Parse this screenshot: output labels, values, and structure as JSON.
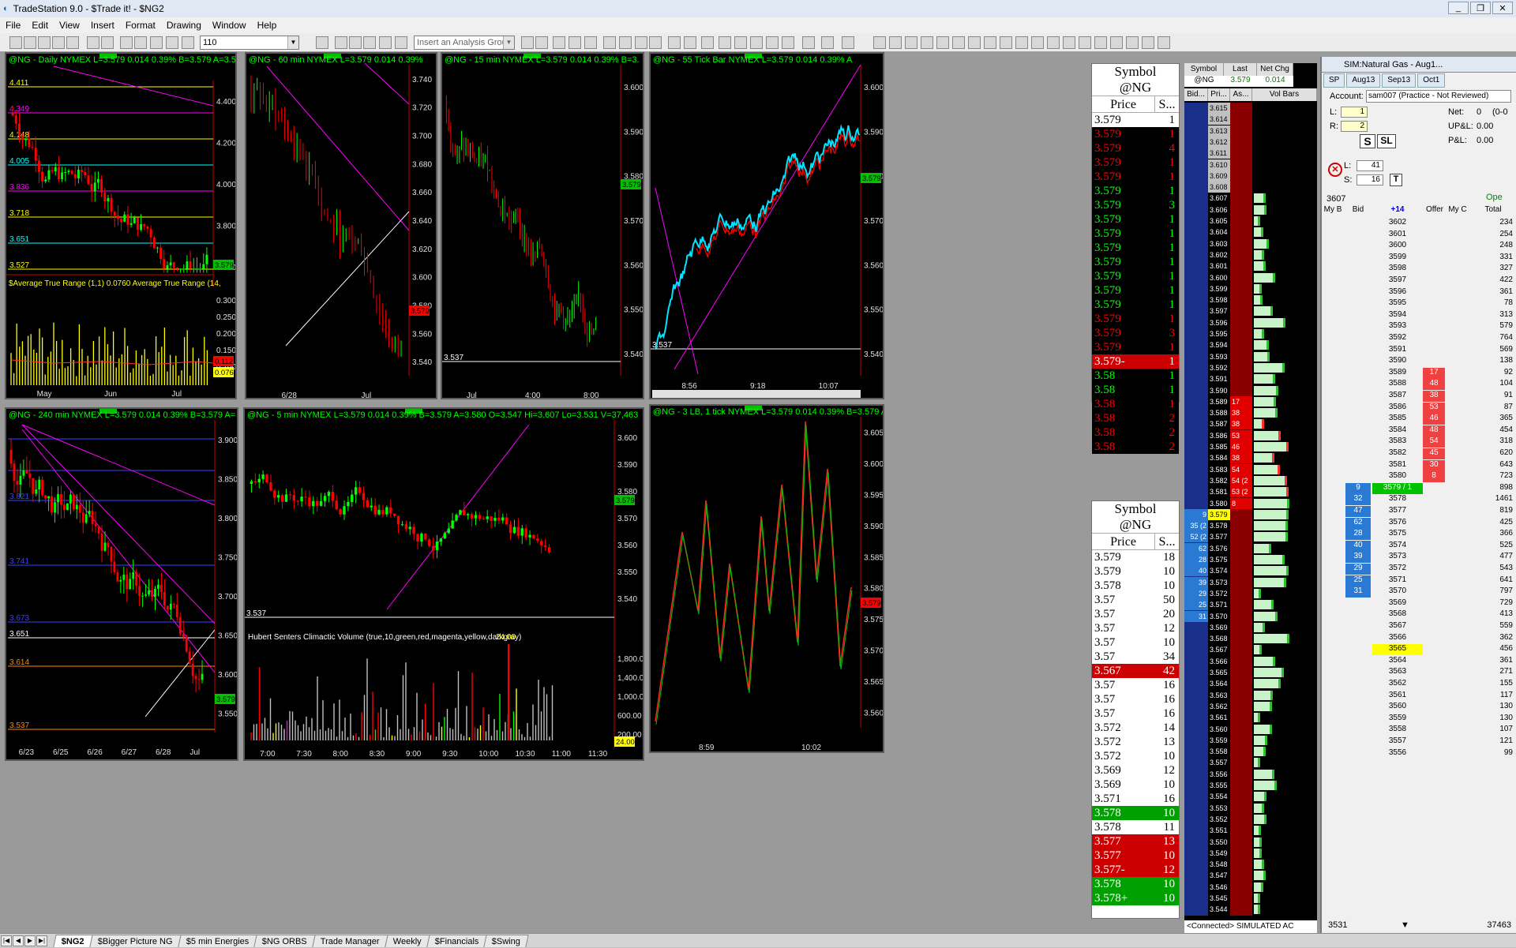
{
  "window": {
    "title": "TradeStation 9.0 - $Trade it! - $NG2",
    "controls": [
      "_",
      "❐",
      "✕"
    ]
  },
  "menu": [
    "File",
    "Edit",
    "View",
    "Insert",
    "Format",
    "Drawing",
    "Window",
    "Help"
  ],
  "toolbar": {
    "interval_value": "110",
    "analysis_placeholder": "Insert an Analysis Group"
  },
  "charts": [
    {
      "id": "daily",
      "header": "@NG - Daily  NYMEX  L=3.579  0.014  0.39%  B=3.579  A=3.5",
      "price_labels": [
        "4.400",
        "4.200",
        "4.000",
        "3.800",
        "3.600"
      ],
      "last": "3.579",
      "levels": [
        {
          "label": "4.411",
          "color": "#ffff00"
        },
        {
          "label": "4.349",
          "color": "#ff00ff"
        },
        {
          "label": "4.148",
          "color": "#ffff00"
        },
        {
          "label": "4.005",
          "color": "#00ffff"
        },
        {
          "label": "3.836",
          "color": "#ff00ff"
        },
        {
          "label": "3.718",
          "color": "#ffff00"
        },
        {
          "label": "3.651",
          "color": "#00ffff"
        },
        {
          "label": "3.527",
          "color": "#ffff00"
        }
      ],
      "indicator": "$Average True Range (1,1)  0.0760  Average True Range (14,",
      "ind_labels": [
        "0.300",
        "0.250",
        "0.200",
        "0.150",
        "0.100"
      ],
      "ind_last1": "0.112",
      "ind_last2": "0.076",
      "dates": [
        "May",
        "Jun",
        "Jul"
      ]
    },
    {
      "id": "60min",
      "header": "@NG - 60 min  NYMEX  L=3.579  0.014  0.39%",
      "price_labels": [
        "3.740",
        "3.720",
        "3.700",
        "3.680",
        "3.660",
        "3.640",
        "3.620",
        "3.600",
        "3.580",
        "3.560",
        "3.540"
      ],
      "last": "3.579",
      "dates": [
        "6/28",
        "Jul"
      ]
    },
    {
      "id": "15min",
      "header": "@NG - 15 min  NYMEX  L=3.579  0.014  0.39%  B=3.",
      "price_labels": [
        "3.600",
        "3.590",
        "3.580",
        "3.570",
        "3.560",
        "3.550",
        "3.540"
      ],
      "last": "3.579",
      "level": "3.537",
      "dates": [
        "Jul",
        "4:00",
        "8:00"
      ]
    },
    {
      "id": "55tick",
      "header": "@NG - 55 Tick Bar  NYMEX  L=3.579  0.014  0.39%  A",
      "price_labels": [
        "3.600",
        "3.590",
        "3.580",
        "3.570",
        "3.560",
        "3.550",
        "3.540"
      ],
      "last": "3.579",
      "level": "3.537",
      "dates": [
        "8:56",
        "9:18",
        "10:07"
      ]
    },
    {
      "id": "240min",
      "header": "@NG - 240 min  NYMEX  L=3.579  0.014  0.39%  B=3.579  A=",
      "price_labels": [
        "3.900",
        "3.850",
        "3.800",
        "3.750",
        "3.700",
        "3.650",
        "3.600",
        "3.550"
      ],
      "last": "3.579",
      "levels": [
        {
          "label": "3.821",
          "color": "#4040ff"
        },
        {
          "label": "3.741",
          "color": "#4040ff"
        },
        {
          "label": "3.673",
          "color": "#4040ff"
        },
        {
          "label": "3.651",
          "color": "#ffffff"
        },
        {
          "label": "3.614",
          "color": "#ff8800"
        },
        {
          "label": "3.537",
          "color": "#ff8800"
        }
      ],
      "dates": [
        "6/23",
        "6/25",
        "6/26",
        "6/27",
        "6/28",
        "Jul"
      ]
    },
    {
      "id": "5min",
      "header": "@NG - 5 min  NYMEX  L=3.579  0.014  0.39%  B=3.579  A=3.580  O=3.547  Hi=3.607  Lo=3.531  V=37,463",
      "price_labels": [
        "3.600",
        "3.590",
        "3.580",
        "3.570",
        "3.560",
        "3.550",
        "3.540"
      ],
      "last": "3.579",
      "level": "3.537",
      "indicator": "Hubert Senters Climactic Volume (true,10,green,red,magenta,yellow,darkgray)",
      "indicator_value": "24.00",
      "ind_labels": [
        "1,800.00",
        "1,400.00",
        "1,000.00",
        "600.00",
        "200.00"
      ],
      "ind_last": "24.00",
      "dates": [
        "7:00",
        "7:30",
        "8:00",
        "8:30",
        "9:00",
        "9:30",
        "10:00",
        "10:30",
        "11:00",
        "11:30"
      ]
    },
    {
      "id": "3lb",
      "header": "@NG - 3 LB, 1 tick  NYMEX  L=3.579  0.014  0.39%  B=3.579  A=",
      "price_labels": [
        "3.605",
        "3.600",
        "3.595",
        "3.590",
        "3.585",
        "3.580",
        "3.575",
        "3.570",
        "3.565",
        "3.560"
      ],
      "last": "3.579",
      "dates": [
        "8:59",
        "10:02"
      ]
    }
  ],
  "ts1": {
    "symbol_header": "Symbol",
    "symbol": "@NG",
    "price_header": "Price",
    "size_header": "S...",
    "rows": [
      [
        "3.579",
        "1",
        "w"
      ],
      [
        "3.579",
        "1",
        "r"
      ],
      [
        "3.579",
        "4",
        "r"
      ],
      [
        "3.579",
        "1",
        "r"
      ],
      [
        "3.579",
        "1",
        "r"
      ],
      [
        "3.579",
        "1",
        "g"
      ],
      [
        "3.579",
        "3",
        "g"
      ],
      [
        "3.579",
        "1",
        "g"
      ],
      [
        "3.579",
        "1",
        "g"
      ],
      [
        "3.579",
        "1",
        "g"
      ],
      [
        "3.579",
        "1",
        "g"
      ],
      [
        "3.579",
        "1",
        "g"
      ],
      [
        "3.579",
        "1",
        "g"
      ],
      [
        "3.579",
        "1",
        "g"
      ],
      [
        "3.579",
        "1",
        "r"
      ],
      [
        "3.579",
        "3",
        "r"
      ],
      [
        "3.579",
        "1",
        "r"
      ],
      [
        "3.579-",
        "1",
        "R"
      ],
      [
        "3.58",
        "1",
        "g"
      ],
      [
        "3.58",
        "1",
        "g"
      ],
      [
        "3.58",
        "1",
        "r"
      ],
      [
        "3.58",
        "2",
        "r"
      ],
      [
        "3.58",
        "2",
        "r"
      ],
      [
        "3.58",
        "2",
        "r"
      ]
    ]
  },
  "ts2": {
    "symbol_header": "Symbol",
    "symbol": "@NG",
    "price_header": "Price",
    "size_header": "S...",
    "rows": [
      [
        "3.579",
        "18",
        "w"
      ],
      [
        "3.579",
        "10",
        "w"
      ],
      [
        "3.578",
        "10",
        "w"
      ],
      [
        "3.57",
        "50",
        "w"
      ],
      [
        "3.57",
        "20",
        "w"
      ],
      [
        "3.57",
        "12",
        "w"
      ],
      [
        "3.57",
        "10",
        "w"
      ],
      [
        "3.57",
        "34",
        "w"
      ],
      [
        "3.567",
        "42",
        "R"
      ],
      [
        "3.57",
        "16",
        "w"
      ],
      [
        "3.57",
        "16",
        "w"
      ],
      [
        "3.57",
        "16",
        "w"
      ],
      [
        "3.572",
        "14",
        "w"
      ],
      [
        "3.572",
        "13",
        "w"
      ],
      [
        "3.572",
        "10",
        "w"
      ],
      [
        "3.569",
        "12",
        "w"
      ],
      [
        "3.569",
        "10",
        "w"
      ],
      [
        "3.571",
        "16",
        "w"
      ],
      [
        "3.578",
        "10",
        "G"
      ],
      [
        "3.578",
        "11",
        "w"
      ],
      [
        "3.577",
        "13",
        "R"
      ],
      [
        "3.577",
        "10",
        "R"
      ],
      [
        "3.577-",
        "12",
        "R"
      ],
      [
        "3.578",
        "10",
        "G"
      ],
      [
        "3.578+",
        "10",
        "G"
      ]
    ]
  },
  "ladder": {
    "col_symbol": "Symbol",
    "col_last": "Last",
    "col_netchg": "Net Chg",
    "symbol": "@NG",
    "last": "3.579",
    "netchg": "0.014",
    "sub_bid": "Bid...",
    "sub_pri": "Pri...",
    "sub_ask": "As...",
    "sub_vol": "Vol Bars",
    "prices": [
      "3.615",
      "3.614",
      "3.613",
      "3.612",
      "3.611",
      "3.610",
      "3.609",
      "3.608",
      "3.607",
      "3.606",
      "3.605",
      "3.604",
      "3.603",
      "3.602",
      "3.601",
      "3.600",
      "3.599",
      "3.598",
      "3.597",
      "3.596",
      "3.595",
      "3.594",
      "3.593",
      "3.592",
      "3.591",
      "3.590",
      "3.589",
      "3.588",
      "3.587",
      "3.586",
      "3.585",
      "3.584",
      "3.583",
      "3.582",
      "3.581",
      "3.580",
      "3.579",
      "3.578",
      "3.577",
      "3.576",
      "3.575",
      "3.574",
      "3.573",
      "3.572",
      "3.571",
      "3.570",
      "3.569",
      "3.568",
      "3.567",
      "3.566",
      "3.565",
      "3.564",
      "3.563",
      "3.562",
      "3.561",
      "3.560",
      "3.559",
      "3.558",
      "3.557",
      "3.556",
      "3.555",
      "3.554",
      "3.553",
      "3.552",
      "3.551",
      "3.550",
      "3.549",
      "3.548",
      "3.547",
      "3.546",
      "3.545",
      "3.544"
    ],
    "asks": {
      "3.589": "17",
      "3.588": "38",
      "3.587": "38",
      "3.586": "53",
      "3.585": "46",
      "3.584": "38",
      "3.583": "54",
      "3.582": "54 (2",
      "3.581": "53 (2",
      "3.580": "8"
    },
    "bids": {
      "3.579": "9",
      "3.578": "35 (2",
      "3.577": "52 (2",
      "3.576": "62",
      "3.575": "28",
      "3.574": "40",
      "3.573": "39",
      "3.572": "29",
      "3.571": "25",
      "3.570": "31"
    },
    "status": "<Connected> SIMULATED AC"
  },
  "tm": {
    "title": "SIM:Natural Gas - Aug1...",
    "buttons": [
      "SP",
      "Aug13",
      "Sep13",
      "Oct1"
    ],
    "account_label": "Account:",
    "account": "sam007 (Practice - Not Reviewed)",
    "net_label": "Net:",
    "net_val": "0",
    "net_extra": "(0-0",
    "upl_label": "UP&L:",
    "upl_val": "0.00",
    "pl_label": "P&L:",
    "pl_val": "0.00",
    "l_label": "L:",
    "l_val": "1",
    "r_label": "R:",
    "r_val": "2",
    "l2_label": "L:",
    "l2_val": "41",
    "s_label": "S:",
    "s_val": "16",
    "t_btn": "T",
    "s_btn": "S",
    "sl_btn": "SL",
    "top_price": "3607",
    "opt": "Ope",
    "hdr_mybid": "My B",
    "hdr_bid": "Bid",
    "hdr_chg": "+14",
    "hdr_offer": "Offer",
    "hdr_myc": "My C",
    "hdr_total": "Total",
    "current": "3579 / 1",
    "highlight_price": "3565",
    "bottom_left": "3531",
    "bottom_right": "37463",
    "rows": [
      [
        "3602",
        "",
        "",
        "234"
      ],
      [
        "3601",
        "",
        "",
        "254"
      ],
      [
        "3600",
        "",
        "",
        "248"
      ],
      [
        "3599",
        "",
        "",
        "331"
      ],
      [
        "3598",
        "",
        "",
        "327"
      ],
      [
        "3597",
        "",
        "",
        "422"
      ],
      [
        "3596",
        "",
        "",
        "361"
      ],
      [
        "3595",
        "",
        "",
        "78"
      ],
      [
        "3594",
        "",
        "",
        "313"
      ],
      [
        "3593",
        "",
        "",
        "579"
      ],
      [
        "3592",
        "",
        "",
        "764"
      ],
      [
        "3591",
        "",
        "",
        "569"
      ],
      [
        "3590",
        "",
        "",
        "138"
      ],
      [
        "3589",
        "",
        "17",
        "92"
      ],
      [
        "3588",
        "",
        "48",
        "104"
      ],
      [
        "3587",
        "",
        "38",
        "91"
      ],
      [
        "3586",
        "",
        "53",
        "87"
      ],
      [
        "3585",
        "",
        "46",
        "365"
      ],
      [
        "3584",
        "",
        "48",
        "454"
      ],
      [
        "3583",
        "",
        "54",
        "318"
      ],
      [
        "3582",
        "",
        "45",
        "620"
      ],
      [
        "3581",
        "",
        "30",
        "643"
      ],
      [
        "3580",
        "",
        "8",
        "723"
      ],
      [
        "3579",
        "9",
        "",
        "898"
      ],
      [
        "3578",
        "32",
        "",
        "1461"
      ],
      [
        "3577",
        "47",
        "",
        "819"
      ],
      [
        "3576",
        "62",
        "",
        "425"
      ],
      [
        "3575",
        "28",
        "",
        "366"
      ],
      [
        "3574",
        "40",
        "",
        "525"
      ],
      [
        "3573",
        "39",
        "",
        "477"
      ],
      [
        "3572",
        "29",
        "",
        "543"
      ],
      [
        "3571",
        "25",
        "",
        "641"
      ],
      [
        "3570",
        "31",
        "",
        "797"
      ],
      [
        "3569",
        "",
        "",
        "729"
      ],
      [
        "3568",
        "",
        "",
        "413"
      ],
      [
        "3567",
        "",
        "",
        "559"
      ],
      [
        "3566",
        "",
        "",
        "362"
      ],
      [
        "3565",
        "",
        "",
        "456"
      ],
      [
        "3564",
        "",
        "",
        "361"
      ],
      [
        "3563",
        "",
        "",
        "271"
      ],
      [
        "3562",
        "",
        "",
        "155"
      ],
      [
        "3561",
        "",
        "",
        "117"
      ],
      [
        "3560",
        "",
        "",
        "130"
      ],
      [
        "3559",
        "",
        "",
        "130"
      ],
      [
        "3558",
        "",
        "",
        "107"
      ],
      [
        "3557",
        "",
        "",
        "121"
      ],
      [
        "3556",
        "",
        "",
        "99"
      ]
    ]
  },
  "tabs": [
    "$NG2",
    "$Bigger Picture NG",
    "$5 min Energies",
    "$NG ORBS",
    "Trade Manager",
    "Weekly",
    "$Financials",
    "$Swing"
  ],
  "colors": {
    "green": "#00ff00",
    "red": "#ff0000",
    "cyan": "#00e5ff",
    "magenta": "#ff00ff",
    "yellow": "#ffff00"
  }
}
